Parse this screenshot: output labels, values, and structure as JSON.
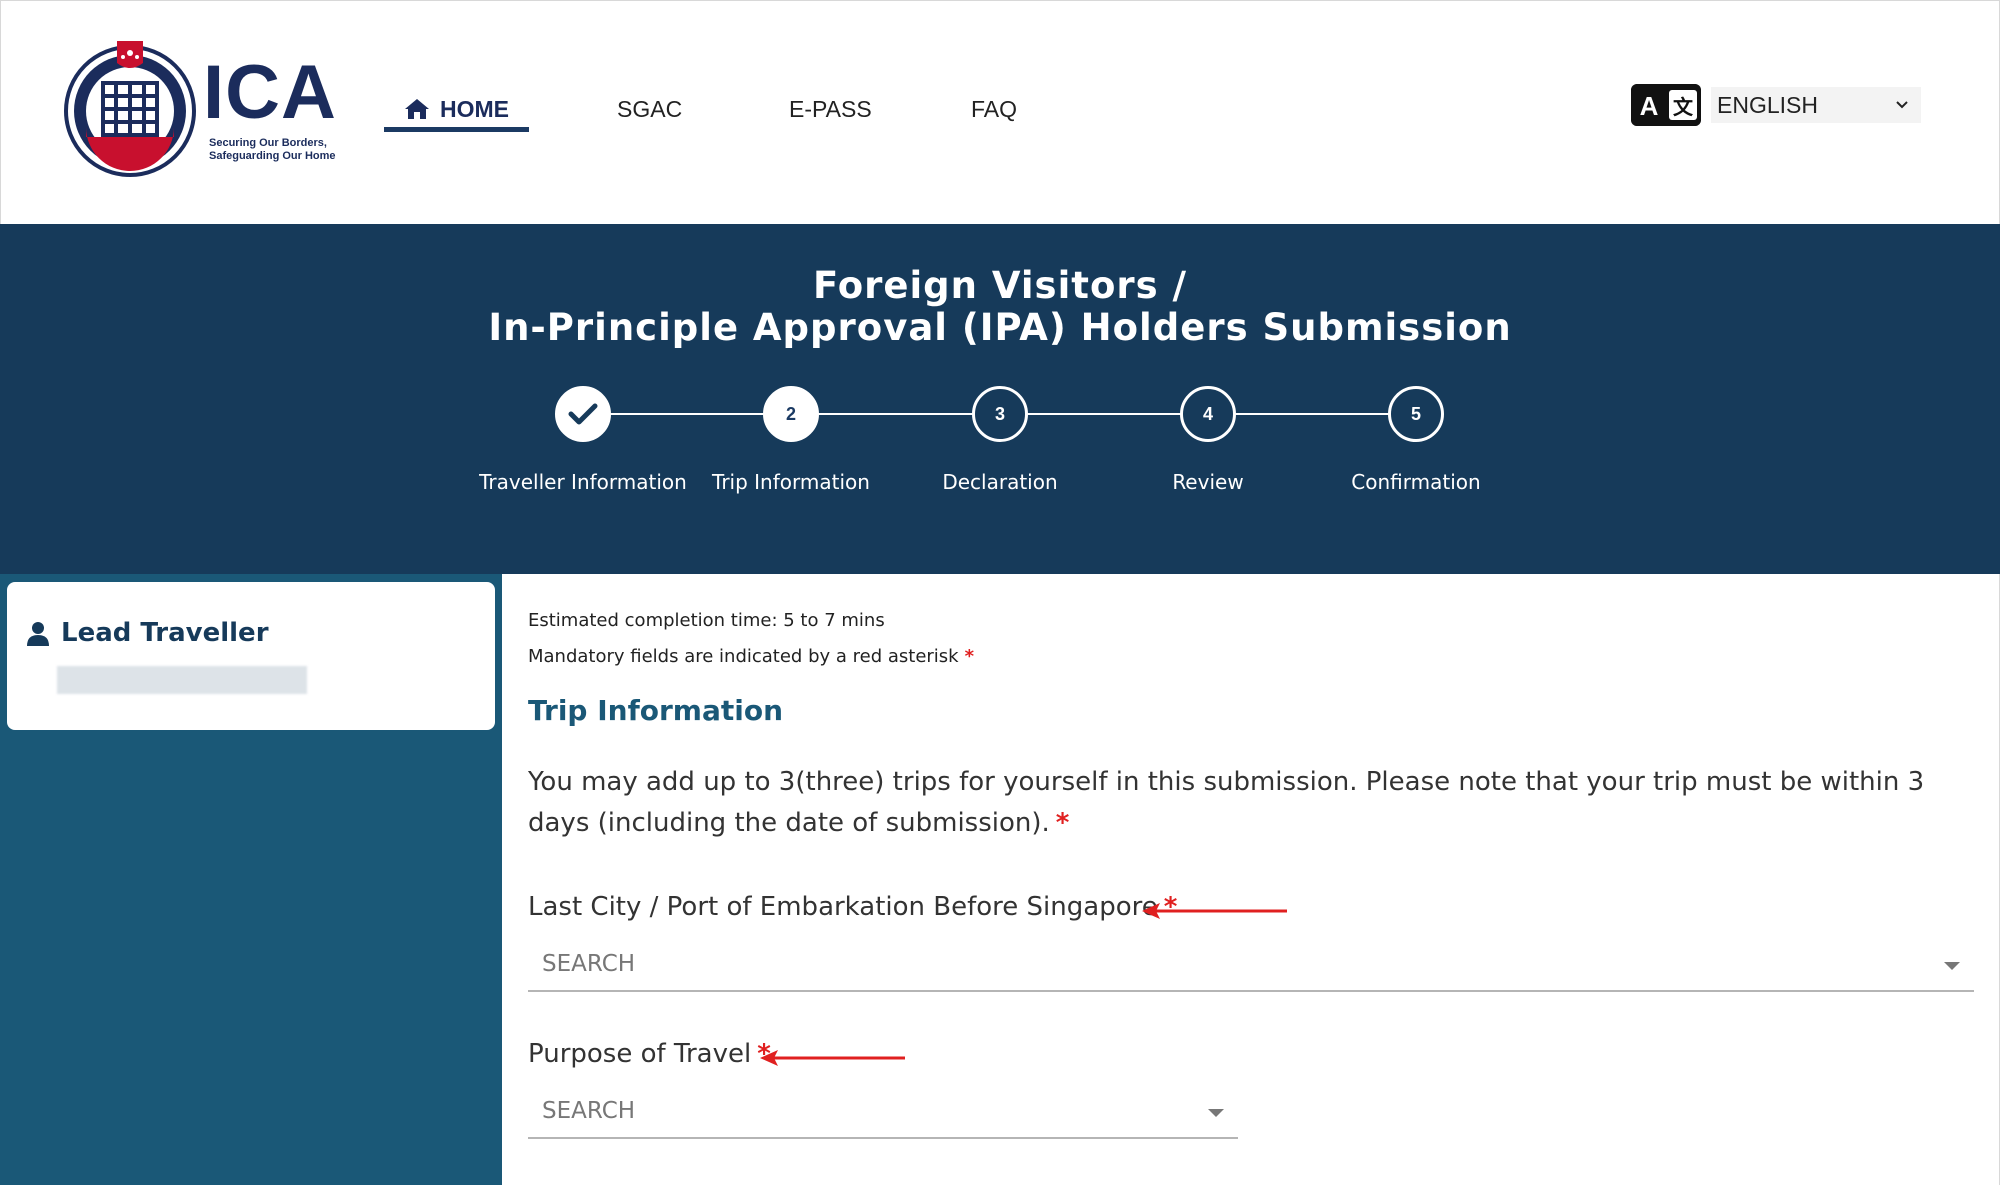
{
  "header": {
    "logo_text": "ICA",
    "logo_tagline_1": "Securing Our Borders,",
    "logo_tagline_2": "Safeguarding Our Home",
    "nav": {
      "home": "HOME",
      "sgac": "SGAC",
      "epass": "E-PASS",
      "faq": "FAQ"
    },
    "language": {
      "selected": "ENGLISH"
    }
  },
  "banner": {
    "title_line1": "Foreign Visitors /",
    "title_line2": "In-Principle Approval (IPA) Holders Submission",
    "steps": [
      {
        "number": "1",
        "label": "Traveller Information",
        "state": "done"
      },
      {
        "number": "2",
        "label": "Trip Information",
        "state": "current"
      },
      {
        "number": "3",
        "label": "Declaration",
        "state": "upcoming"
      },
      {
        "number": "4",
        "label": "Review",
        "state": "upcoming"
      },
      {
        "number": "5",
        "label": "Confirmation",
        "state": "upcoming"
      }
    ]
  },
  "sidebar": {
    "traveller_title": "Lead Traveller"
  },
  "form": {
    "estimated_time": "Estimated completion time: 5 to 7 mins",
    "mandatory_note": "Mandatory fields are indicated by a red asterisk",
    "asterisk": "*",
    "section_title": "Trip Information",
    "description": "You may add up to 3(three) trips for yourself in this submission. Please note that your trip must be within 3 days (including the date of submission).",
    "city": {
      "label": "Last City / Port of Embarkation Before Singapore",
      "placeholder": "SEARCH",
      "value": ""
    },
    "purpose": {
      "label": "Purpose of Travel",
      "placeholder": "SEARCH",
      "value": ""
    }
  },
  "colors": {
    "banner_bg": "#163a5a",
    "sidebar_bg": "#1a5877",
    "brand_navy": "#1b2c5c",
    "required_red": "#e02020"
  }
}
